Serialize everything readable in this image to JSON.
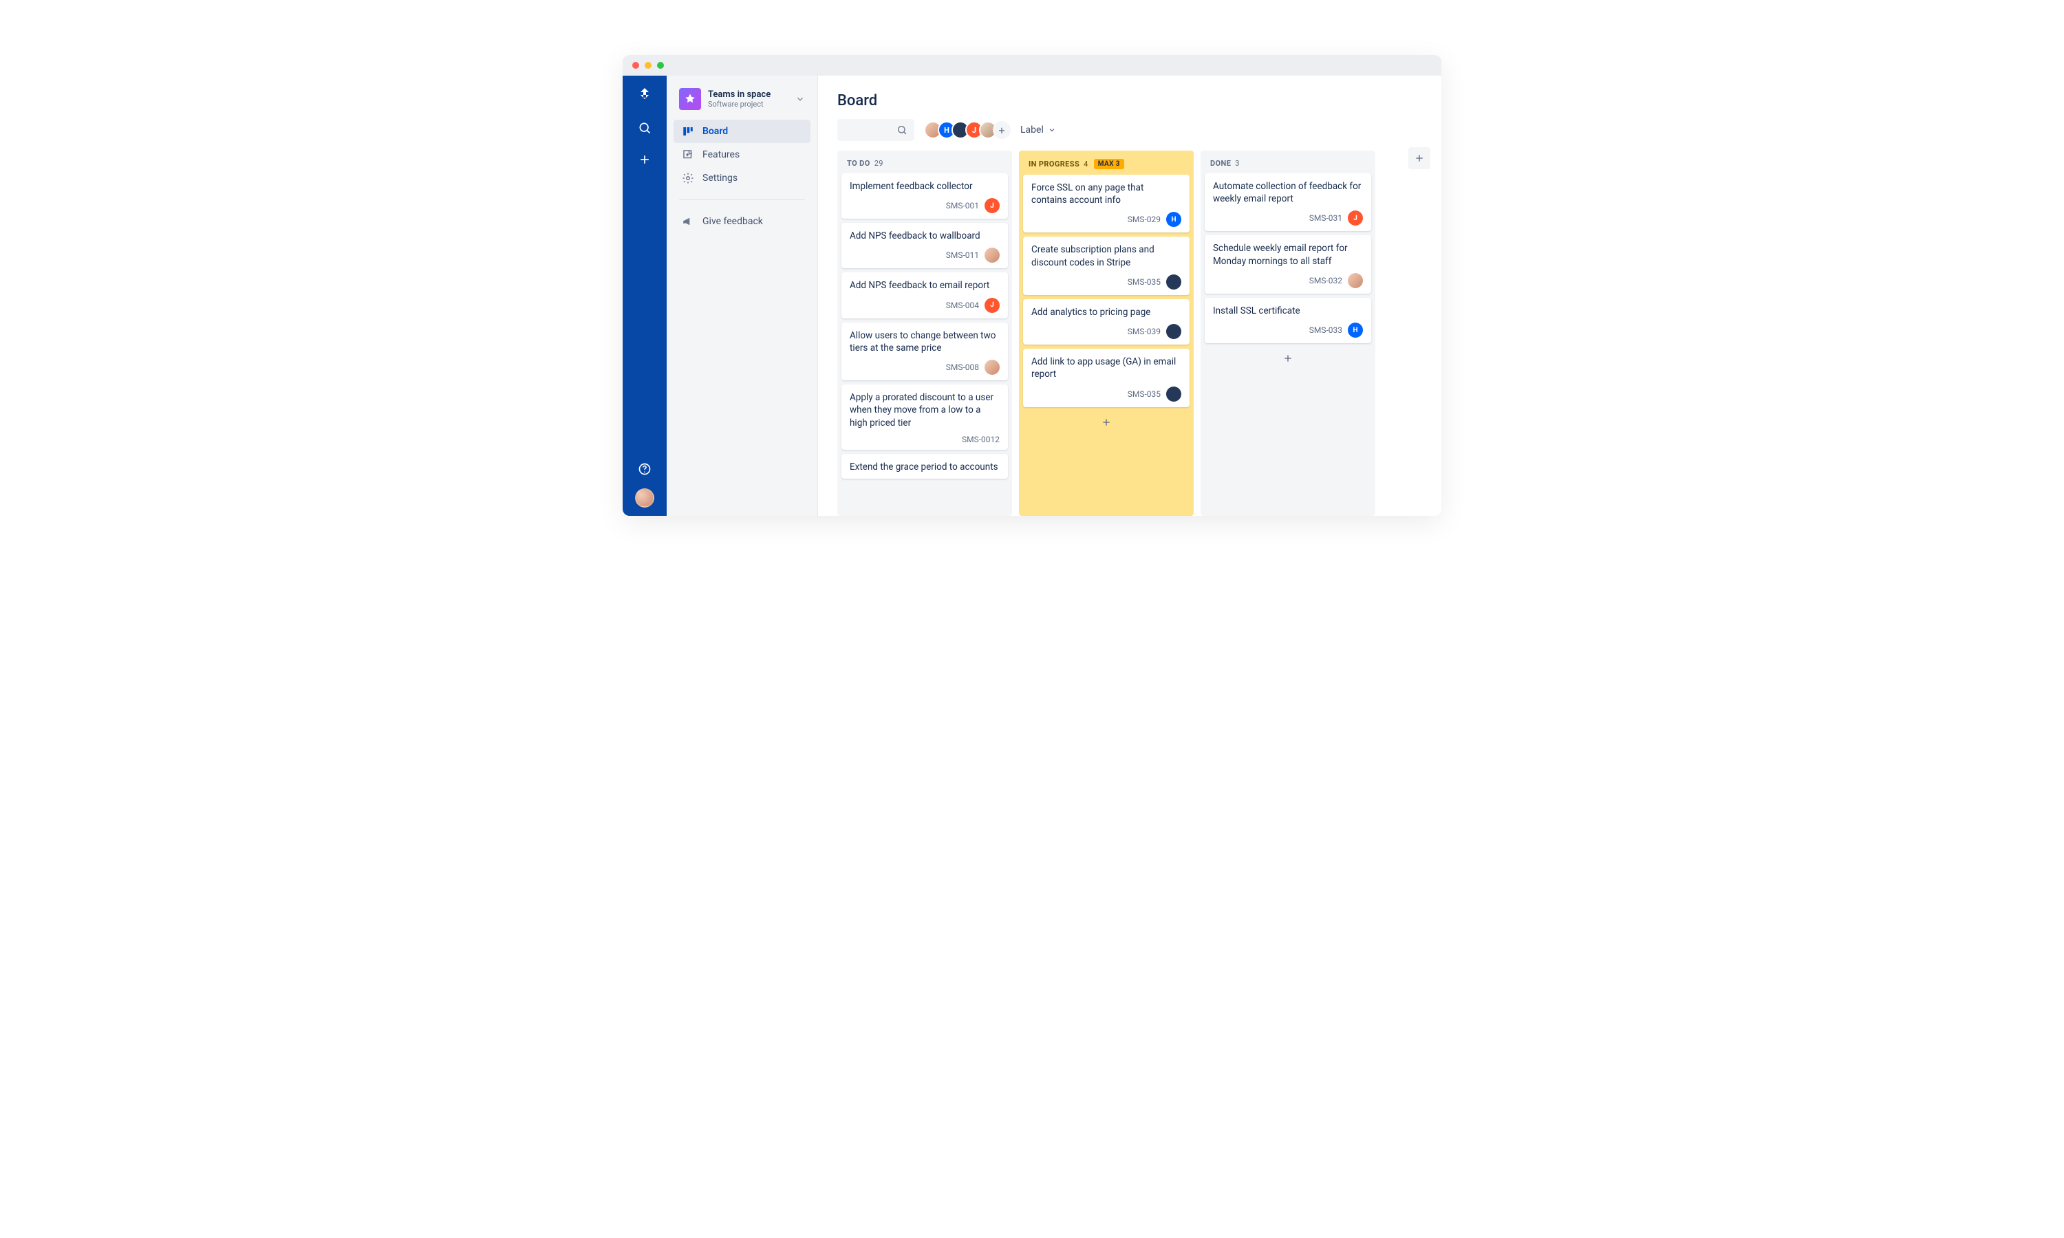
{
  "project": {
    "name": "Teams in space",
    "type": "Software project"
  },
  "nav": {
    "board": "Board",
    "features": "Features",
    "settings": "Settings",
    "feedback": "Give feedback"
  },
  "page_title": "Board",
  "filter": {
    "label": "Label"
  },
  "avatars": [
    {
      "bg": "linear-gradient(135deg,#f5ccb8,#c98b6d)",
      "text": ""
    },
    {
      "bg": "#0065ff",
      "text": "H"
    },
    {
      "bg": "#253858",
      "text": ""
    },
    {
      "bg": "#ff5630",
      "text": "J"
    },
    {
      "bg": "linear-gradient(135deg,#ead9c6,#b89072)",
      "text": ""
    }
  ],
  "avatar_add": "+",
  "columns": [
    {
      "name": "TO DO",
      "count": "29",
      "warn": false,
      "cards": [
        {
          "title": "Implement feedback collector",
          "key": "SMS-001",
          "assignee": {
            "bg": "#ff5630",
            "text": "J"
          }
        },
        {
          "title": "Add NPS feedback to wallboard",
          "key": "SMS-011",
          "assignee": {
            "bg": "linear-gradient(135deg,#f5ccb8,#c98b6d)",
            "text": ""
          }
        },
        {
          "title": "Add NPS feedback to email report",
          "key": "SMS-004",
          "assignee": {
            "bg": "#ff5630",
            "text": "J"
          }
        },
        {
          "title": "Allow users to change between two tiers at the same price",
          "key": "SMS-008",
          "assignee": {
            "bg": "linear-gradient(135deg,#f5ccb8,#c98b6d)",
            "text": ""
          }
        },
        {
          "title": "Apply a prorated discount to a user when they move from a low to a high priced tier",
          "key": "SMS-0012",
          "assignee": null
        },
        {
          "title": "Extend the grace period to accounts",
          "key": "",
          "assignee": null
        }
      ],
      "show_add": false
    },
    {
      "name": "IN PROGRESS",
      "count": "4",
      "badge": "MAX 3",
      "warn": true,
      "cards": [
        {
          "title": "Force SSL on any page that contains account info",
          "key": "SMS-029",
          "assignee": {
            "bg": "#0065ff",
            "text": "H"
          }
        },
        {
          "title": "Create subscription plans and discount codes in Stripe",
          "key": "SMS-035",
          "assignee": {
            "bg": "#253858",
            "text": ""
          }
        },
        {
          "title": "Add analytics to pricing page",
          "key": "SMS-039",
          "assignee": {
            "bg": "#253858",
            "text": ""
          }
        },
        {
          "title": "Add link to app usage (GA) in email report",
          "key": "SMS-035",
          "assignee": {
            "bg": "#253858",
            "text": ""
          }
        }
      ],
      "show_add": true
    },
    {
      "name": "DONE",
      "count": "3",
      "warn": false,
      "cards": [
        {
          "title": "Automate collection of feedback for weekly email report",
          "key": "SMS-031",
          "assignee": {
            "bg": "#ff5630",
            "text": "J"
          }
        },
        {
          "title": "Schedule weekly email report for Monday mornings to all staff",
          "key": "SMS-032",
          "assignee": {
            "bg": "linear-gradient(135deg,#f5ccb8,#c98b6d)",
            "text": ""
          }
        },
        {
          "title": "Install SSL certificate",
          "key": "SMS-033",
          "assignee": {
            "bg": "#0065ff",
            "text": "H"
          }
        }
      ],
      "show_add": true
    }
  ]
}
